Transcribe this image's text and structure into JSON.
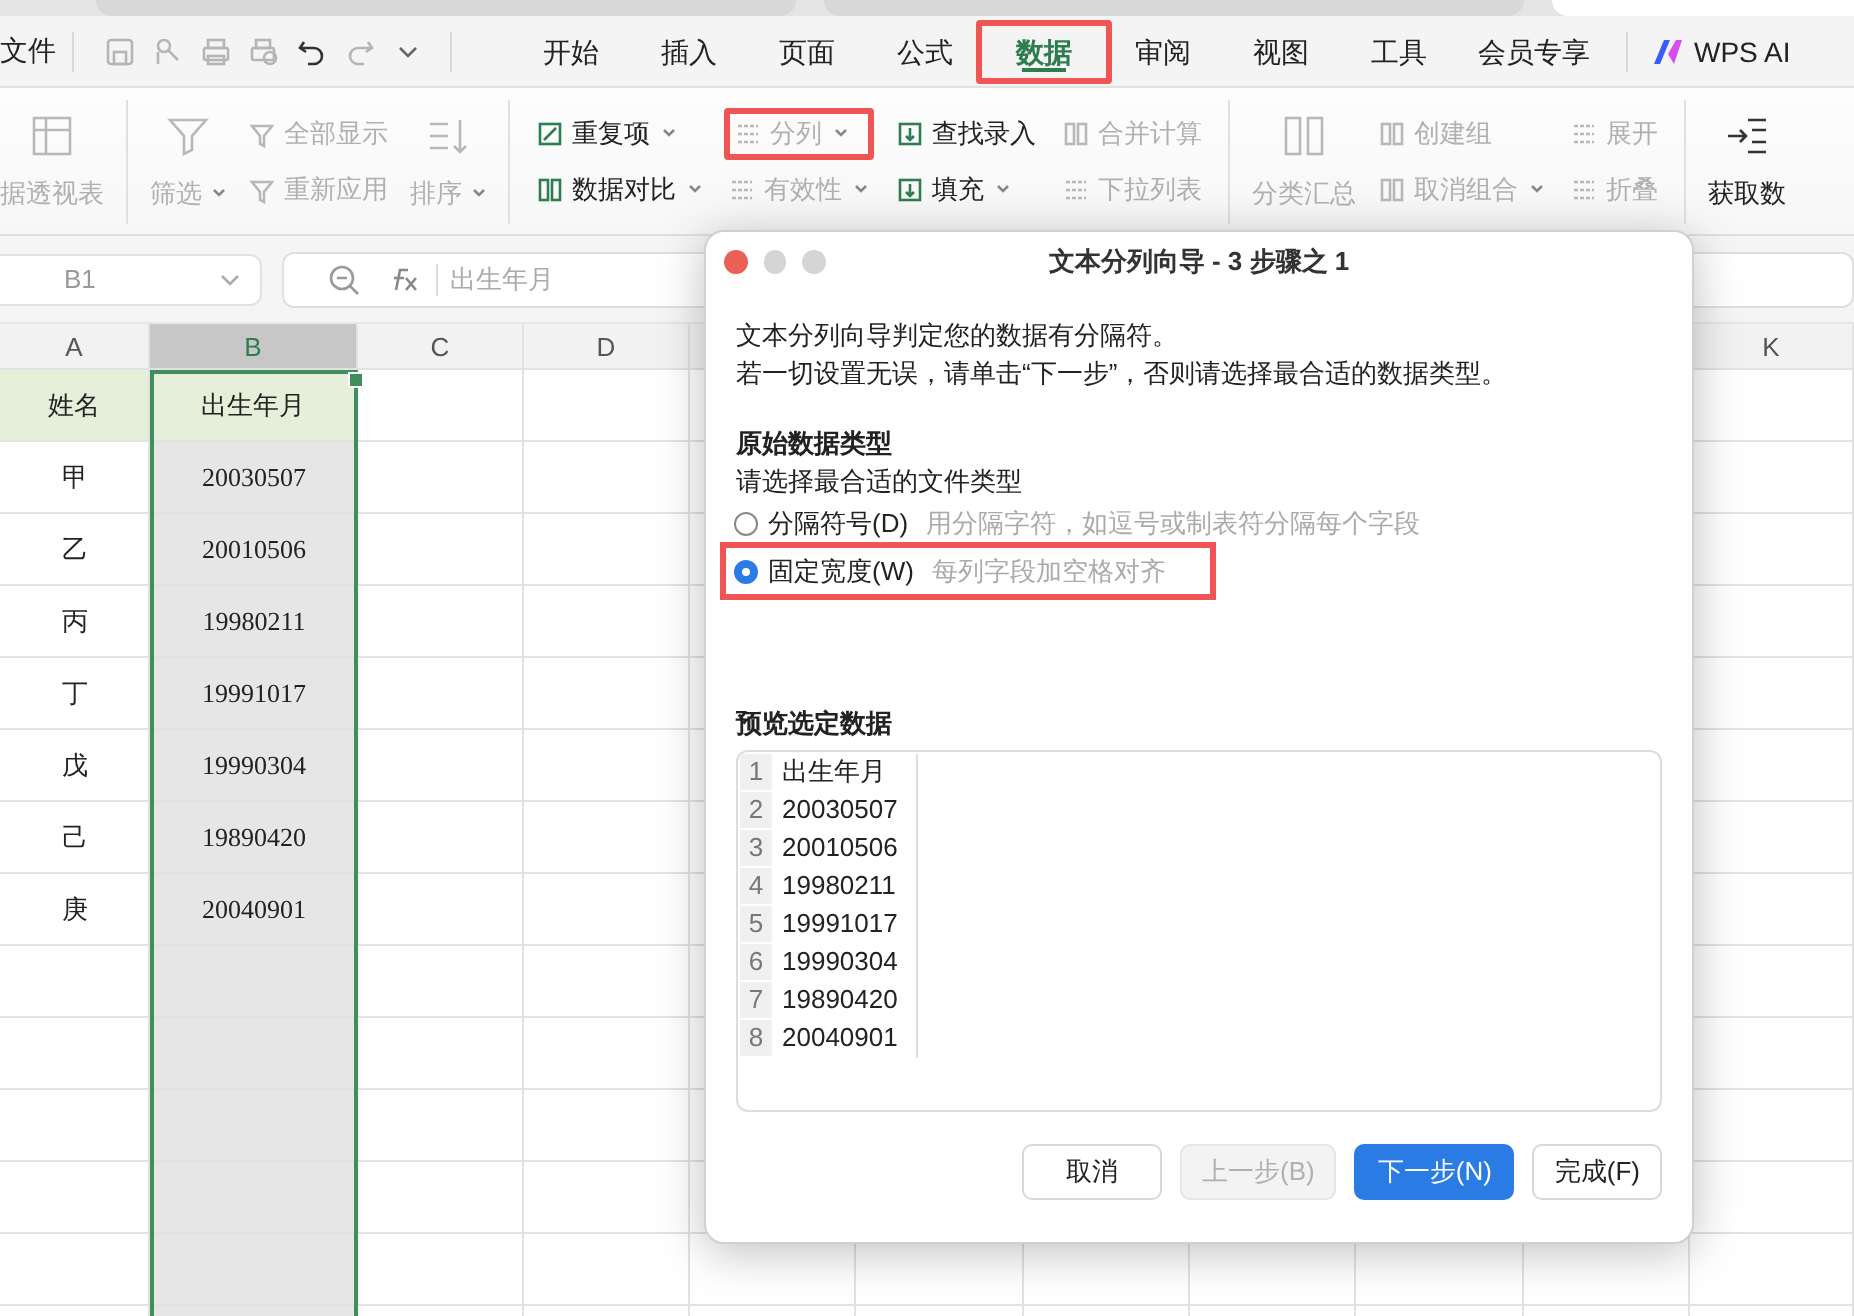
{
  "menu": {
    "file": "文件",
    "tabs": [
      {
        "label": "开始",
        "selected": false,
        "highlighted": false
      },
      {
        "label": "插入",
        "selected": false,
        "highlighted": false
      },
      {
        "label": "页面",
        "selected": false,
        "highlighted": false
      },
      {
        "label": "公式",
        "selected": false,
        "highlighted": false
      },
      {
        "label": "数据",
        "selected": true,
        "highlighted": true
      },
      {
        "label": "审阅",
        "selected": false,
        "highlighted": false
      },
      {
        "label": "视图",
        "selected": false,
        "highlighted": false
      },
      {
        "label": "工具",
        "selected": false,
        "highlighted": false
      },
      {
        "label": "会员专享",
        "selected": false,
        "highlighted": false
      }
    ],
    "ai_label": "WPS AI"
  },
  "ribbon": {
    "groups": [
      {
        "items": [
          {
            "kind": "large",
            "label": "据透视表",
            "disabled": true,
            "dropdown": false,
            "highlighted": false
          }
        ]
      },
      {
        "items": [
          {
            "kind": "large",
            "label": "筛选",
            "disabled": true,
            "dropdown": true,
            "highlighted": false
          },
          {
            "kind": "stack",
            "buttons": [
              {
                "label": "全部显示",
                "disabled": true,
                "dropdown": false,
                "highlighted": false
              },
              {
                "label": "重新应用",
                "disabled": true,
                "dropdown": false,
                "highlighted": false
              }
            ]
          },
          {
            "kind": "large",
            "label": "排序",
            "disabled": true,
            "dropdown": true,
            "highlighted": false
          }
        ]
      },
      {
        "items": [
          {
            "kind": "stack",
            "buttons": [
              {
                "label": "重复项",
                "disabled": false,
                "dropdown": true,
                "highlighted": false
              },
              {
                "label": "数据对比",
                "disabled": false,
                "dropdown": true,
                "highlighted": false
              }
            ]
          },
          {
            "kind": "stack",
            "buttons": [
              {
                "label": "分列",
                "disabled": true,
                "dropdown": true,
                "highlighted": true
              },
              {
                "label": "有效性",
                "disabled": true,
                "dropdown": true,
                "highlighted": false
              }
            ]
          },
          {
            "kind": "stack",
            "buttons": [
              {
                "label": "查找录入",
                "disabled": false,
                "dropdown": false,
                "highlighted": false
              },
              {
                "label": "填充",
                "disabled": false,
                "dropdown": true,
                "highlighted": false
              }
            ]
          },
          {
            "kind": "stack",
            "buttons": [
              {
                "label": "合并计算",
                "disabled": true,
                "dropdown": false,
                "highlighted": false
              },
              {
                "label": "下拉列表",
                "disabled": true,
                "dropdown": false,
                "highlighted": false
              }
            ]
          }
        ]
      },
      {
        "items": [
          {
            "kind": "large",
            "label": "分类汇总",
            "disabled": true,
            "dropdown": false,
            "highlighted": false
          },
          {
            "kind": "stack",
            "buttons": [
              {
                "label": "创建组",
                "disabled": true,
                "dropdown": false,
                "highlighted": false
              },
              {
                "label": "取消组合",
                "disabled": true,
                "dropdown": true,
                "highlighted": false
              }
            ]
          },
          {
            "kind": "stack",
            "buttons": [
              {
                "label": "展开",
                "disabled": true,
                "dropdown": false,
                "highlighted": false
              },
              {
                "label": "折叠",
                "disabled": true,
                "dropdown": false,
                "highlighted": false
              }
            ]
          }
        ]
      },
      {
        "items": [
          {
            "kind": "large",
            "label": "获取数",
            "disabled": false,
            "dropdown": false,
            "highlighted": false
          }
        ]
      }
    ]
  },
  "formula_bar": {
    "cell_ref": "B1",
    "content": "出生年月"
  },
  "sheet": {
    "columns": [
      {
        "label": "A",
        "selected": false
      },
      {
        "label": "B",
        "selected": true
      },
      {
        "label": "C",
        "selected": false
      },
      {
        "label": "D",
        "selected": false
      },
      {
        "label": "K",
        "selected": false
      }
    ],
    "rows": [
      {
        "kind": "header",
        "cells": [
          "姓名",
          "出生年月"
        ]
      },
      {
        "kind": "data",
        "cells": [
          "甲",
          "20030507"
        ]
      },
      {
        "kind": "data",
        "cells": [
          "乙",
          "20010506"
        ]
      },
      {
        "kind": "data",
        "cells": [
          "丙",
          "19980211"
        ]
      },
      {
        "kind": "data",
        "cells": [
          "丁",
          "19991017"
        ]
      },
      {
        "kind": "data",
        "cells": [
          "戊",
          "19990304"
        ]
      },
      {
        "kind": "data",
        "cells": [
          "己",
          "19890420"
        ]
      },
      {
        "kind": "data",
        "cells": [
          "庚",
          "20040901"
        ]
      }
    ]
  },
  "dialog": {
    "title": "文本分列向导 - 3 步骤之 1",
    "description": [
      "文本分列向导判定您的数据有分隔符。",
      "若一切设置无误，请单击“下一步”，否则请选择最合适的数据类型。"
    ],
    "section_title": "原始数据类型",
    "prompt": "请选择最合适的文件类型",
    "options": [
      {
        "label": "分隔符号(D)",
        "hint": "用分隔字符，如逗号或制表符分隔每个字段",
        "selected": false,
        "highlighted": false
      },
      {
        "label": "固定宽度(W)",
        "hint": "每列字段加空格对齐",
        "selected": true,
        "highlighted": true
      }
    ],
    "preview_title": "预览选定数据",
    "preview_rows": [
      {
        "number": "1",
        "text": "出生年月"
      },
      {
        "number": "2",
        "text": "20030507"
      },
      {
        "number": "3",
        "text": "20010506"
      },
      {
        "number": "4",
        "text": "19980211"
      },
      {
        "number": "5",
        "text": "19991017"
      },
      {
        "number": "6",
        "text": "19990304"
      },
      {
        "number": "7",
        "text": "19890420"
      },
      {
        "number": "8",
        "text": "20040901"
      }
    ],
    "buttons": [
      {
        "label": "取消",
        "kind": "default",
        "disabled": false
      },
      {
        "label": "上一步(B)",
        "kind": "default",
        "disabled": true
      },
      {
        "label": "下一步(N)",
        "kind": "primary",
        "disabled": false
      },
      {
        "label": "完成(F)",
        "kind": "default",
        "disabled": false
      }
    ]
  }
}
